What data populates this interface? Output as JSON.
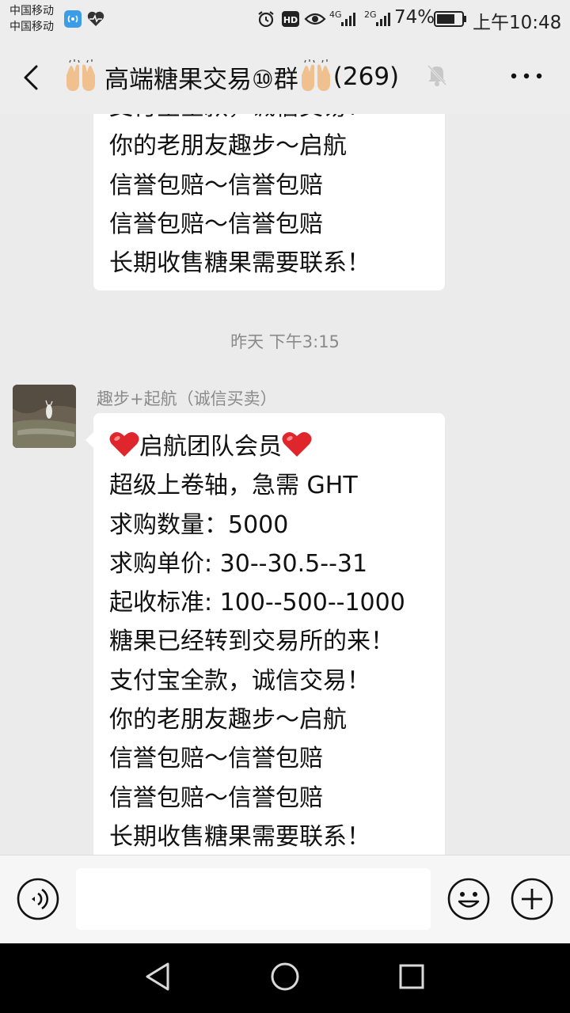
{
  "status_bar": {
    "carrier_1": "中国移动",
    "carrier_2": "中国移动",
    "network_1": "4G",
    "network_2": "2G",
    "battery": "74%",
    "time": "上午10:48",
    "icons": [
      "wifi-hotspot-icon",
      "health-heart-icon",
      "alarm-icon",
      "hd-icon",
      "eye-icon",
      "signal-icon",
      "battery-icon"
    ]
  },
  "header": {
    "title_emoji": "raising-hands-emoji",
    "title": "高端糖果交易⑩群",
    "member_count": "(269)",
    "muted": true,
    "icons": [
      "back-icon",
      "mute-icon",
      "more-icon"
    ]
  },
  "chat": {
    "previous_message": {
      "lines": [
        "支付宝全款，诚信交易！",
        "你的老朋友趣步～启航",
        "信誉包赔～信誉包赔",
        "信誉包赔～信誉包赔",
        "长期收售糖果需要联系！"
      ]
    },
    "timestamp": "昨天 下午3:15",
    "message": {
      "sender": "趣步+起航（诚信买卖）",
      "header_text": "启航团队会员",
      "header_emoji": "red-heart-emoji",
      "lines": [
        "超级上卷轴，急需 GHT",
        "求购数量：5000",
        "求购单价:   30--30.5--31",
        "起收标准:  100--500--1000",
        "糖果已经转到交易所的来！",
        "支付宝全款，诚信交易！",
        "你的老朋友趣步～启航",
        "信誉包赔～信誉包赔",
        "信誉包赔～信誉包赔",
        "长期收售糖果需要联系！"
      ]
    }
  },
  "input_bar": {
    "value": "",
    "icons": [
      "voice-icon",
      "emoji-icon",
      "plus-icon"
    ]
  },
  "system_nav": {
    "icons": [
      "nav-back-icon",
      "nav-home-icon",
      "nav-recents-icon"
    ]
  },
  "colors": {
    "chat_background": "#ebebeb",
    "header_background": "#ededed",
    "bubble_background": "#ffffff",
    "meta_text": "#8a8a8a",
    "system_nav": "#000000",
    "heart": "#e0262d"
  }
}
